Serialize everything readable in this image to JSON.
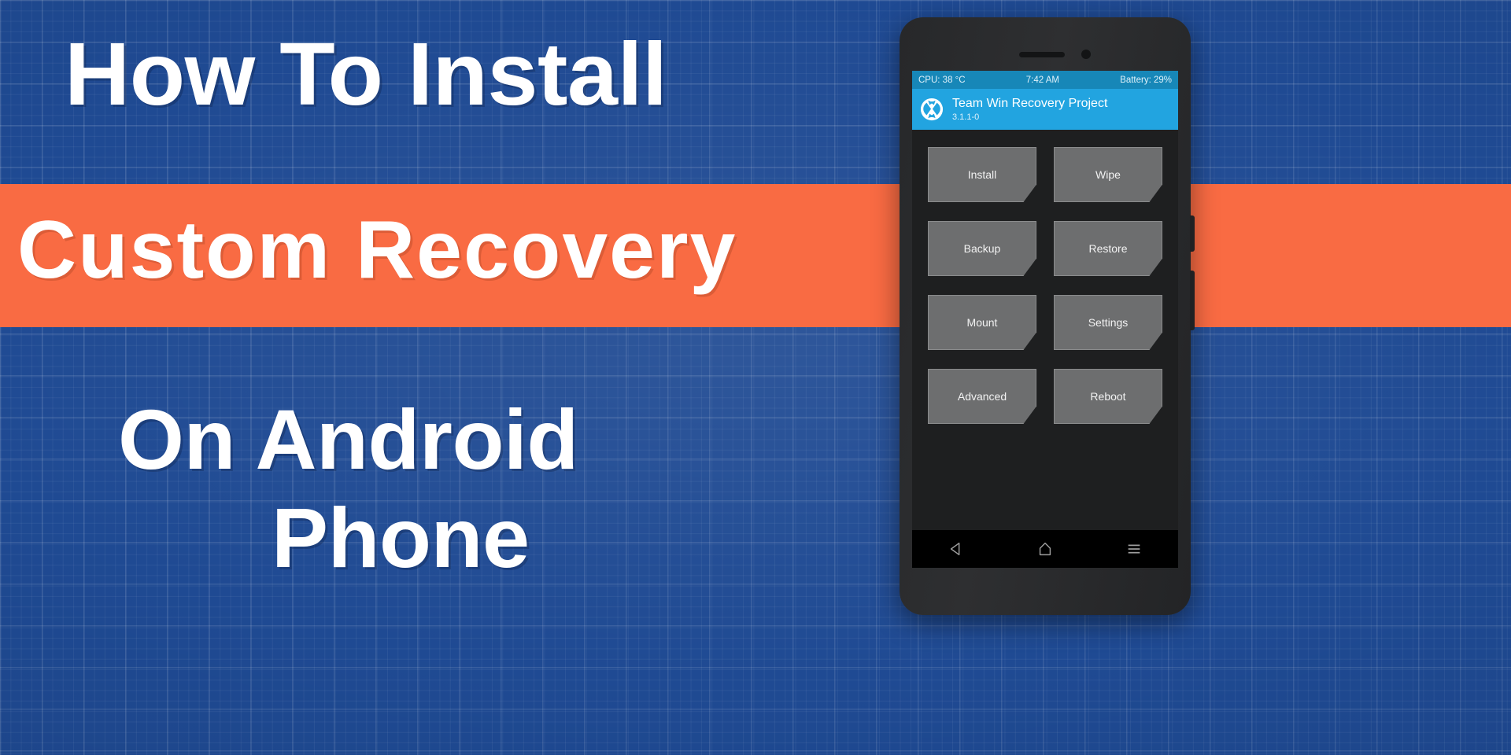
{
  "background": {
    "style_name": "blueprint-grid",
    "blue": "#1f4a93",
    "accent_orange": "#f96b43"
  },
  "headlines": {
    "line1": "How To Install",
    "line2": "Custom Recovery",
    "line3": "On Android",
    "line4": "Phone"
  },
  "phone": {
    "screen": {
      "status_bar": {
        "cpu": "CPU: 38 °C",
        "time": "7:42 AM",
        "battery": "Battery: 29%"
      },
      "app_header": {
        "logo_icon": "twrp-logo-icon",
        "title": "Team Win Recovery Project",
        "version": "3.1.1-0",
        "background": "#22a4e0"
      },
      "buttons": [
        {
          "label": "Install"
        },
        {
          "label": "Wipe"
        },
        {
          "label": "Backup"
        },
        {
          "label": "Restore"
        },
        {
          "label": "Mount"
        },
        {
          "label": "Settings"
        },
        {
          "label": "Advanced"
        },
        {
          "label": "Reboot"
        }
      ],
      "nav_bar": {
        "back_icon": "back-triangle-icon",
        "home_icon": "home-icon",
        "recents_icon": "menu-lines-icon"
      }
    },
    "hardware": {
      "speaker_icon": "earpiece-speaker-icon",
      "camera_icon": "front-camera-icon",
      "power_button": "power-button",
      "volume_button": "volume-button"
    }
  }
}
